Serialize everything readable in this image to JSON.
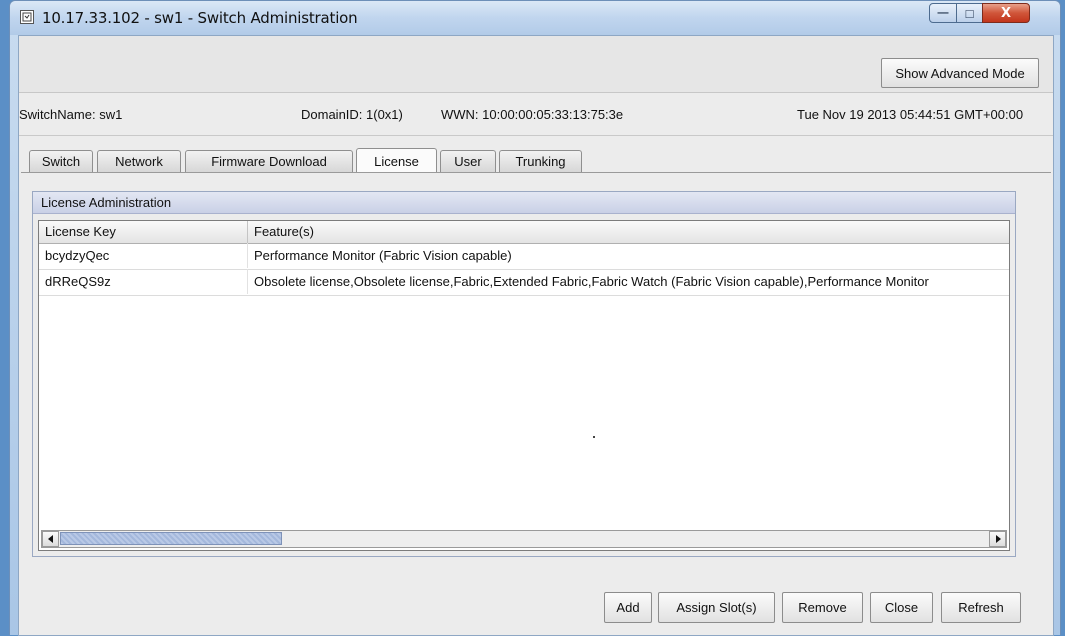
{
  "window": {
    "title": "10.17.33.102 - sw1 - Switch Administration",
    "min_glyph": "—",
    "max_glyph": "□",
    "close_glyph": "X"
  },
  "toolbar": {
    "advanced_label": "Show Advanced Mode"
  },
  "info": {
    "switch_name": "SwitchName: sw1",
    "domain_id": "DomainID: 1(0x1)",
    "wwn": "WWN: 10:00:00:05:33:13:75:3e",
    "datetime": "Tue Nov 19 2013 05:44:51 GMT+00:00"
  },
  "tabs": [
    {
      "label": "Switch"
    },
    {
      "label": "Network"
    },
    {
      "label": "Firmware Download"
    },
    {
      "label": "License"
    },
    {
      "label": "User"
    },
    {
      "label": "Trunking"
    }
  ],
  "active_tab": "License",
  "license_panel": {
    "title": "License Administration",
    "columns": [
      "License Key",
      "Feature(s)"
    ],
    "rows": [
      {
        "key": "bcydzyQec",
        "features": "Performance Monitor (Fabric Vision capable)"
      },
      {
        "key": "dRReQS9z",
        "features": "Obsolete license,Obsolete license,Fabric,Extended Fabric,Fabric Watch (Fabric Vision capable),Performance Monitor"
      }
    ]
  },
  "actions": {
    "add": "Add",
    "assign_slots": "Assign Slot(s)",
    "remove": "Remove",
    "close": "Close",
    "refresh": "Refresh"
  }
}
